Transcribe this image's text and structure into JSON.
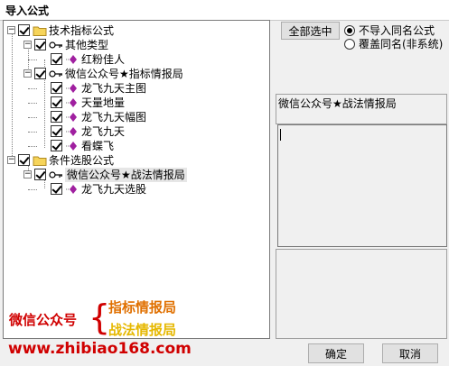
{
  "window": {
    "title": "导入公式"
  },
  "tree": [
    {
      "label": "技术指标公式",
      "type": "folder",
      "level": 0,
      "expanded": true
    },
    {
      "label": "其他类型",
      "type": "key",
      "level": 1,
      "expanded": true
    },
    {
      "label": "红粉佳人",
      "type": "formula",
      "level": 2
    },
    {
      "label": "微信公众号★指标情报局",
      "type": "key",
      "level": 1,
      "expanded": true
    },
    {
      "label": "龙飞九天主图",
      "type": "formula",
      "level": 2
    },
    {
      "label": "天量地量",
      "type": "formula",
      "level": 2
    },
    {
      "label": "龙飞九天幅图",
      "type": "formula",
      "level": 2
    },
    {
      "label": "龙飞九天",
      "type": "formula",
      "level": 2
    },
    {
      "label": "看蝶飞",
      "type": "formula",
      "level": 2
    },
    {
      "label": "条件选股公式",
      "type": "folder",
      "level": 0,
      "expanded": true
    },
    {
      "label": "微信公众号★战法情报局",
      "type": "key",
      "level": 1,
      "expanded": true,
      "selected": true
    },
    {
      "label": "龙飞九天选股",
      "type": "formula",
      "level": 2
    }
  ],
  "right": {
    "select_all_label": "全部选中",
    "radio_options": [
      {
        "label": "不导入同名公式",
        "checked": true
      },
      {
        "label": "覆盖同名(非系统)",
        "checked": false
      }
    ],
    "info_text": "微信公众号★战法情报局"
  },
  "buttons": {
    "ok": "确定",
    "cancel": "取消"
  },
  "promo": {
    "left": "微信公众号",
    "brace": "{",
    "right1": "指标情报局",
    "right2": "战法情报局",
    "url": "www.zhibiao168.com"
  },
  "colors": {
    "red": "#d00000",
    "orange": "#e07000",
    "gold": "#e6b800",
    "formula_icon": "#a020a0"
  }
}
